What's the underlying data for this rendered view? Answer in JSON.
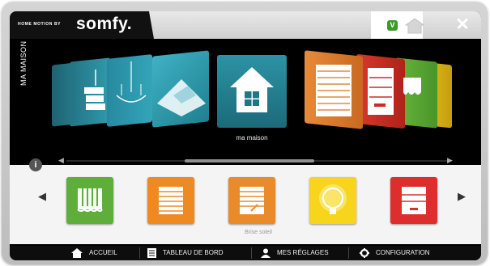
{
  "header": {
    "logo_prefix": "HOME MOTION BY",
    "logo_brand": "somfy.",
    "notification_badge": "V",
    "close_label": "✕"
  },
  "main": {
    "side_label": "MA MAISON",
    "selected_label": "ma maison",
    "scroll_left": "◀",
    "scroll_right": "▶"
  },
  "equipment": {
    "info_label": "i",
    "prev_label": "◀",
    "next_label": "▶",
    "selected_label": "Brise soleil",
    "tile_colors": [
      "#5fae3b",
      "#ef8a23",
      "#e98b2a",
      "#f7d51d",
      "#dd2e2e"
    ]
  },
  "bottom_nav": {
    "items": [
      {
        "label": "ACCUEIL",
        "icon": "home-icon"
      },
      {
        "label": "TABLEAU DE BORD",
        "icon": "dashboard-icon"
      },
      {
        "label": "MES RÉGLAGES",
        "icon": "user-icon"
      },
      {
        "label": "CONFIGURATION",
        "icon": "gear-icon"
      }
    ]
  },
  "colors": {
    "accent_teal": "#2c93a4",
    "notification_green": "#3d9a2a"
  }
}
